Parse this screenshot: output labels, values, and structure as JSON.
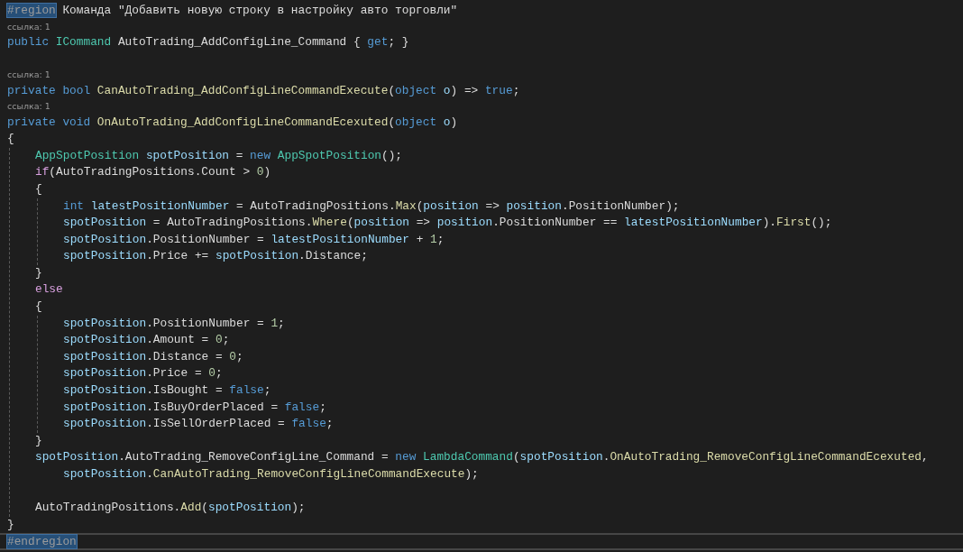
{
  "editor": {
    "lines": [
      {
        "kind": "code",
        "tokens": [
          {
            "text": "#region",
            "kind": "directive",
            "highlighted": true
          },
          {
            "text": " Команда \"Добавить новую строку в настройку авто торговли\"",
            "kind": "plain"
          }
        ]
      },
      {
        "kind": "lens",
        "text": "ссылка: 1"
      },
      {
        "kind": "code",
        "tokens": [
          {
            "text": "public ",
            "kind": "keyword"
          },
          {
            "text": "ICommand",
            "kind": "type"
          },
          {
            "text": " AutoTrading_AddConfigLine_Command { ",
            "kind": "plain"
          },
          {
            "text": "get",
            "kind": "keyword"
          },
          {
            "text": "; }",
            "kind": "plain"
          }
        ]
      },
      {
        "kind": "blank"
      },
      {
        "kind": "lens",
        "text": "ссылка: 1"
      },
      {
        "kind": "code",
        "tokens": [
          {
            "text": "private bool ",
            "kind": "keyword"
          },
          {
            "text": "CanAutoTrading_AddConfigLineCommandExecute",
            "kind": "method"
          },
          {
            "text": "(",
            "kind": "plain"
          },
          {
            "text": "object ",
            "kind": "keyword"
          },
          {
            "text": "o",
            "kind": "variable"
          },
          {
            "text": ") => ",
            "kind": "plain"
          },
          {
            "text": "true",
            "kind": "keyword"
          },
          {
            "text": ";",
            "kind": "plain"
          }
        ]
      },
      {
        "kind": "lens",
        "text": "ссылка: 1"
      },
      {
        "kind": "code",
        "tokens": [
          {
            "text": "private void ",
            "kind": "keyword"
          },
          {
            "text": "OnAutoTrading_AddConfigLineCommandEcexuted",
            "kind": "method"
          },
          {
            "text": "(",
            "kind": "plain"
          },
          {
            "text": "object ",
            "kind": "keyword"
          },
          {
            "text": "o",
            "kind": "variable"
          },
          {
            "text": ")",
            "kind": "plain"
          }
        ]
      },
      {
        "kind": "code",
        "tokens": [
          {
            "text": "{",
            "kind": "plain"
          }
        ]
      },
      {
        "kind": "block",
        "lines": [
          {
            "kind": "code",
            "tokens": [
              {
                "text": "AppSpotPosition ",
                "kind": "type"
              },
              {
                "text": "spotPosition",
                "kind": "variable"
              },
              {
                "text": " = ",
                "kind": "plain"
              },
              {
                "text": "new ",
                "kind": "keyword"
              },
              {
                "text": "AppSpotPosition",
                "kind": "type"
              },
              {
                "text": "();",
                "kind": "plain"
              }
            ]
          },
          {
            "kind": "code",
            "tokens": [
              {
                "text": "if",
                "kind": "control"
              },
              {
                "text": "(AutoTradingPositions.Count > ",
                "kind": "plain"
              },
              {
                "text": "0",
                "kind": "number"
              },
              {
                "text": ")",
                "kind": "plain"
              }
            ]
          },
          {
            "kind": "code",
            "tokens": [
              {
                "text": "{",
                "kind": "plain"
              }
            ]
          },
          {
            "kind": "block",
            "lines": [
              {
                "kind": "code",
                "tokens": [
                  {
                    "text": "int ",
                    "kind": "keyword"
                  },
                  {
                    "text": "latestPositionNumber",
                    "kind": "variable"
                  },
                  {
                    "text": " = AutoTradingPositions.",
                    "kind": "plain"
                  },
                  {
                    "text": "Max",
                    "kind": "method"
                  },
                  {
                    "text": "(",
                    "kind": "plain"
                  },
                  {
                    "text": "position",
                    "kind": "variable"
                  },
                  {
                    "text": " => ",
                    "kind": "plain"
                  },
                  {
                    "text": "position",
                    "kind": "variable"
                  },
                  {
                    "text": ".PositionNumber);",
                    "kind": "plain"
                  }
                ]
              },
              {
                "kind": "code",
                "tokens": [
                  {
                    "text": "spotPosition",
                    "kind": "variable"
                  },
                  {
                    "text": " = AutoTradingPositions.",
                    "kind": "plain"
                  },
                  {
                    "text": "Where",
                    "kind": "method"
                  },
                  {
                    "text": "(",
                    "kind": "plain"
                  },
                  {
                    "text": "position",
                    "kind": "variable"
                  },
                  {
                    "text": " => ",
                    "kind": "plain"
                  },
                  {
                    "text": "position",
                    "kind": "variable"
                  },
                  {
                    "text": ".PositionNumber == ",
                    "kind": "plain"
                  },
                  {
                    "text": "latestPositionNumber",
                    "kind": "variable"
                  },
                  {
                    "text": ").",
                    "kind": "plain"
                  },
                  {
                    "text": "First",
                    "kind": "method"
                  },
                  {
                    "text": "();",
                    "kind": "plain"
                  }
                ]
              },
              {
                "kind": "code",
                "tokens": [
                  {
                    "text": "spotPosition",
                    "kind": "variable"
                  },
                  {
                    "text": ".PositionNumber = ",
                    "kind": "plain"
                  },
                  {
                    "text": "latestPositionNumber",
                    "kind": "variable"
                  },
                  {
                    "text": " + ",
                    "kind": "plain"
                  },
                  {
                    "text": "1",
                    "kind": "number"
                  },
                  {
                    "text": ";",
                    "kind": "plain"
                  }
                ]
              },
              {
                "kind": "code",
                "tokens": [
                  {
                    "text": "spotPosition",
                    "kind": "variable"
                  },
                  {
                    "text": ".Price += ",
                    "kind": "plain"
                  },
                  {
                    "text": "spotPosition",
                    "kind": "variable"
                  },
                  {
                    "text": ".Distance;",
                    "kind": "plain"
                  }
                ]
              }
            ]
          },
          {
            "kind": "code",
            "tokens": [
              {
                "text": "}",
                "kind": "plain"
              }
            ]
          },
          {
            "kind": "code",
            "tokens": [
              {
                "text": "else",
                "kind": "control"
              }
            ]
          },
          {
            "kind": "code",
            "tokens": [
              {
                "text": "{",
                "kind": "plain"
              }
            ]
          },
          {
            "kind": "block",
            "lines": [
              {
                "kind": "code",
                "tokens": [
                  {
                    "text": "spotPosition",
                    "kind": "variable"
                  },
                  {
                    "text": ".PositionNumber = ",
                    "kind": "plain"
                  },
                  {
                    "text": "1",
                    "kind": "number"
                  },
                  {
                    "text": ";",
                    "kind": "plain"
                  }
                ]
              },
              {
                "kind": "code",
                "tokens": [
                  {
                    "text": "spotPosition",
                    "kind": "variable"
                  },
                  {
                    "text": ".Amount = ",
                    "kind": "plain"
                  },
                  {
                    "text": "0",
                    "kind": "number"
                  },
                  {
                    "text": ";",
                    "kind": "plain"
                  }
                ]
              },
              {
                "kind": "code",
                "tokens": [
                  {
                    "text": "spotPosition",
                    "kind": "variable"
                  },
                  {
                    "text": ".Distance = ",
                    "kind": "plain"
                  },
                  {
                    "text": "0",
                    "kind": "number"
                  },
                  {
                    "text": ";",
                    "kind": "plain"
                  }
                ]
              },
              {
                "kind": "code",
                "tokens": [
                  {
                    "text": "spotPosition",
                    "kind": "variable"
                  },
                  {
                    "text": ".Price = ",
                    "kind": "plain"
                  },
                  {
                    "text": "0",
                    "kind": "number"
                  },
                  {
                    "text": ";",
                    "kind": "plain"
                  }
                ]
              },
              {
                "kind": "code",
                "tokens": [
                  {
                    "text": "spotPosition",
                    "kind": "variable"
                  },
                  {
                    "text": ".IsBought = ",
                    "kind": "plain"
                  },
                  {
                    "text": "false",
                    "kind": "keyword"
                  },
                  {
                    "text": ";",
                    "kind": "plain"
                  }
                ]
              },
              {
                "kind": "code",
                "tokens": [
                  {
                    "text": "spotPosition",
                    "kind": "variable"
                  },
                  {
                    "text": ".IsBuyOrderPlaced = ",
                    "kind": "plain"
                  },
                  {
                    "text": "false",
                    "kind": "keyword"
                  },
                  {
                    "text": ";",
                    "kind": "plain"
                  }
                ]
              },
              {
                "kind": "code",
                "tokens": [
                  {
                    "text": "spotPosition",
                    "kind": "variable"
                  },
                  {
                    "text": ".IsSellOrderPlaced = ",
                    "kind": "plain"
                  },
                  {
                    "text": "false",
                    "kind": "keyword"
                  },
                  {
                    "text": ";",
                    "kind": "plain"
                  }
                ]
              }
            ]
          },
          {
            "kind": "code",
            "tokens": [
              {
                "text": "}",
                "kind": "plain"
              }
            ]
          },
          {
            "kind": "code",
            "tokens": [
              {
                "text": "spotPosition",
                "kind": "variable"
              },
              {
                "text": ".AutoTrading_RemoveConfigLine_Command = ",
                "kind": "plain"
              },
              {
                "text": "new ",
                "kind": "keyword"
              },
              {
                "text": "LambdaCommand",
                "kind": "type"
              },
              {
                "text": "(",
                "kind": "plain"
              },
              {
                "text": "spotPosition",
                "kind": "variable"
              },
              {
                "text": ".",
                "kind": "plain"
              },
              {
                "text": "OnAutoTrading_RemoveConfigLineCommandEcexuted",
                "kind": "method"
              },
              {
                "text": ",",
                "kind": "plain"
              }
            ]
          },
          {
            "kind": "code",
            "continued": true,
            "tokens": [
              {
                "text": "spotPosition",
                "kind": "variable"
              },
              {
                "text": ".",
                "kind": "plain"
              },
              {
                "text": "CanAutoTrading_RemoveConfigLineCommandExecute",
                "kind": "method"
              },
              {
                "text": ");",
                "kind": "plain"
              }
            ]
          },
          {
            "kind": "blank"
          },
          {
            "kind": "code",
            "tokens": [
              {
                "text": "AutoTradingPositions.",
                "kind": "plain"
              },
              {
                "text": "Add",
                "kind": "method"
              },
              {
                "text": "(",
                "kind": "plain"
              },
              {
                "text": "spotPosition",
                "kind": "variable"
              },
              {
                "text": ");",
                "kind": "plain"
              }
            ]
          }
        ]
      },
      {
        "kind": "code",
        "tokens": [
          {
            "text": "}",
            "kind": "plain"
          }
        ]
      },
      {
        "kind": "code",
        "current": true,
        "tokens": [
          {
            "text": "#endregion",
            "kind": "directive",
            "highlighted": true
          }
        ]
      }
    ]
  }
}
